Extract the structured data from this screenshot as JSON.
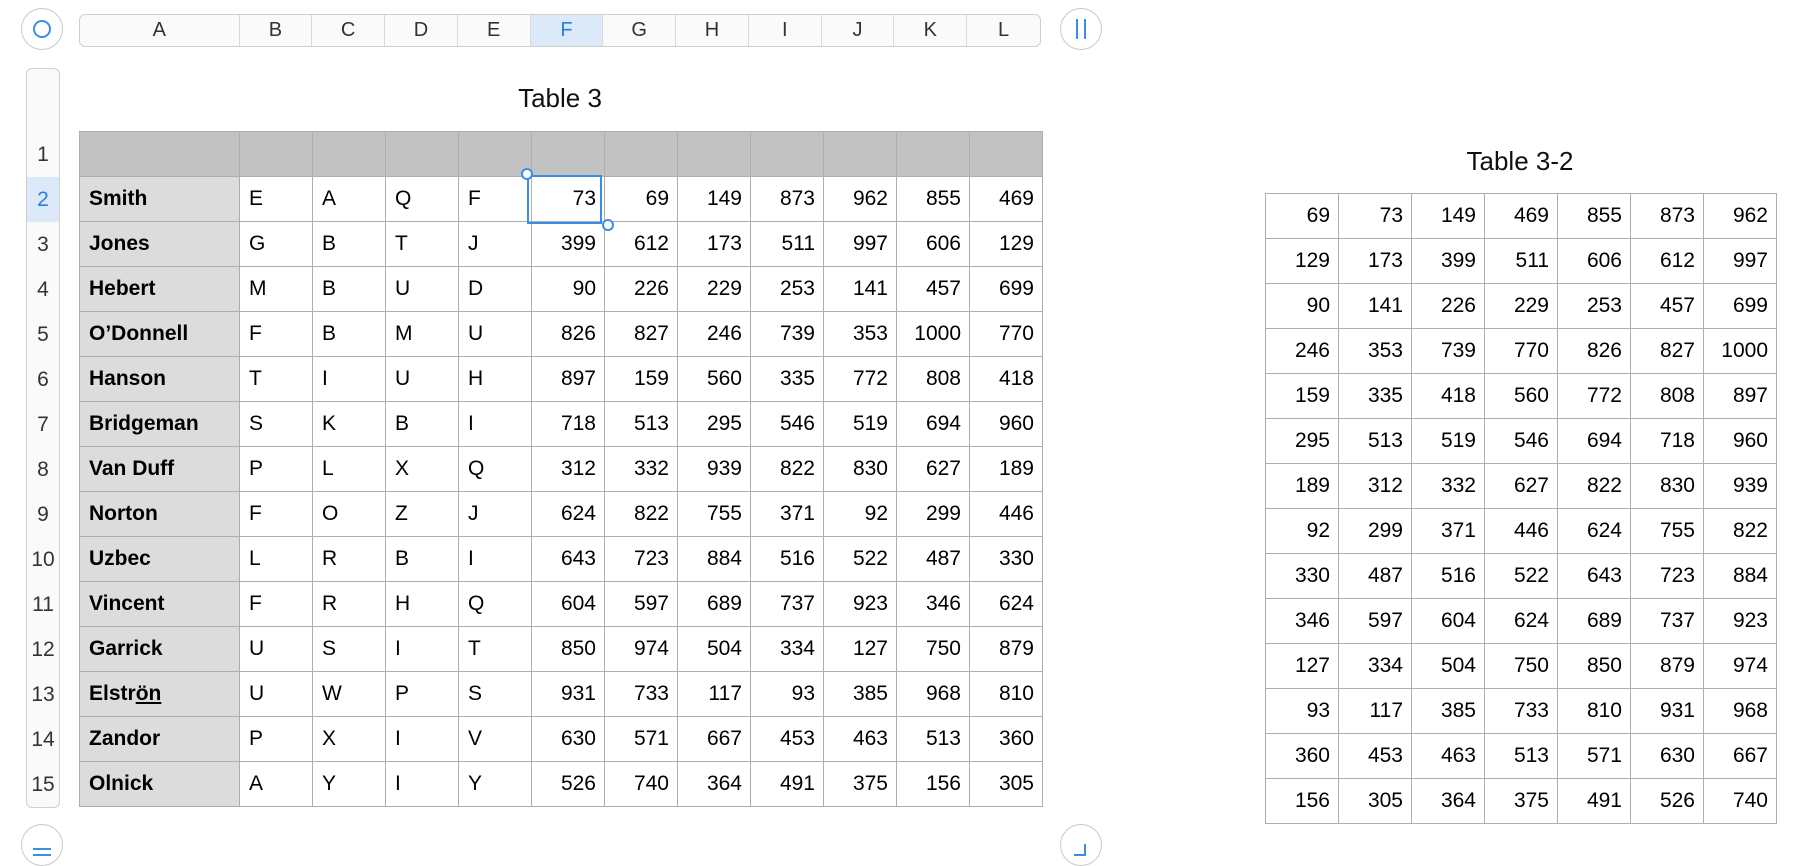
{
  "columns": [
    "A",
    "B",
    "C",
    "D",
    "E",
    "F",
    "G",
    "H",
    "I",
    "J",
    "K",
    "L"
  ],
  "selected_column": "F",
  "rows": [
    "1",
    "2",
    "3",
    "4",
    "5",
    "6",
    "7",
    "8",
    "9",
    "10",
    "11",
    "12",
    "13",
    "14",
    "15"
  ],
  "selected_row": "2",
  "table3": {
    "title": "Table 3",
    "rows": [
      {
        "name": "Smith",
        "letters": [
          "E",
          "A",
          "Q",
          "F"
        ],
        "values": [
          "73",
          "69",
          "149",
          "873",
          "962",
          "855",
          "469"
        ]
      },
      {
        "name": "Jones",
        "letters": [
          "G",
          "B",
          "T",
          "J"
        ],
        "values": [
          "399",
          "612",
          "173",
          "511",
          "997",
          "606",
          "129"
        ]
      },
      {
        "name": "Hebert",
        "letters": [
          "M",
          "B",
          "U",
          "D"
        ],
        "values": [
          "90",
          "226",
          "229",
          "253",
          "141",
          "457",
          "699"
        ]
      },
      {
        "name": "O’Donnell",
        "letters": [
          "F",
          "B",
          "M",
          "U"
        ],
        "values": [
          "826",
          "827",
          "246",
          "739",
          "353",
          "1000",
          "770"
        ]
      },
      {
        "name": "Hanson",
        "letters": [
          "T",
          "I",
          "U",
          "H"
        ],
        "values": [
          "897",
          "159",
          "560",
          "335",
          "772",
          "808",
          "418"
        ]
      },
      {
        "name": "Bridgeman",
        "letters": [
          "S",
          "K",
          "B",
          "I"
        ],
        "values": [
          "718",
          "513",
          "295",
          "546",
          "519",
          "694",
          "960"
        ]
      },
      {
        "name": "Van Duff",
        "letters": [
          "P",
          "L",
          "X",
          "Q"
        ],
        "values": [
          "312",
          "332",
          "939",
          "822",
          "830",
          "627",
          "189"
        ]
      },
      {
        "name": "Norton",
        "letters": [
          "F",
          "O",
          "Z",
          "J"
        ],
        "values": [
          "624",
          "822",
          "755",
          "371",
          "92",
          "299",
          "446"
        ]
      },
      {
        "name": "Uzbec",
        "letters": [
          "L",
          "R",
          "B",
          "I"
        ],
        "values": [
          "643",
          "723",
          "884",
          "516",
          "522",
          "487",
          "330"
        ]
      },
      {
        "name": "Vincent",
        "letters": [
          "F",
          "R",
          "H",
          "Q"
        ],
        "values": [
          "604",
          "597",
          "689",
          "737",
          "923",
          "346",
          "624"
        ]
      },
      {
        "name": "Garrick",
        "letters": [
          "U",
          "S",
          "I",
          "T"
        ],
        "values": [
          "850",
          "974",
          "504",
          "334",
          "127",
          "750",
          "879"
        ]
      },
      {
        "name": "Elströn",
        "letters": [
          "U",
          "W",
          "P",
          "S"
        ],
        "values": [
          "931",
          "733",
          "117",
          "93",
          "385",
          "968",
          "810"
        ]
      },
      {
        "name": "Zandor",
        "letters": [
          "P",
          "X",
          "I",
          "V"
        ],
        "values": [
          "630",
          "571",
          "667",
          "453",
          "463",
          "513",
          "360"
        ]
      },
      {
        "name": "Olnick",
        "letters": [
          "A",
          "Y",
          "I",
          "Y"
        ],
        "values": [
          "526",
          "740",
          "364",
          "491",
          "375",
          "156",
          "305"
        ]
      }
    ]
  },
  "table32": {
    "title": "Table 3-2",
    "rows": [
      [
        "69",
        "73",
        "149",
        "469",
        "855",
        "873",
        "962"
      ],
      [
        "129",
        "173",
        "399",
        "511",
        "606",
        "612",
        "997"
      ],
      [
        "90",
        "141",
        "226",
        "229",
        "253",
        "457",
        "699"
      ],
      [
        "246",
        "353",
        "739",
        "770",
        "826",
        "827",
        "1000"
      ],
      [
        "159",
        "335",
        "418",
        "560",
        "772",
        "808",
        "897"
      ],
      [
        "295",
        "513",
        "519",
        "546",
        "694",
        "718",
        "960"
      ],
      [
        "189",
        "312",
        "332",
        "627",
        "822",
        "830",
        "939"
      ],
      [
        "92",
        "299",
        "371",
        "446",
        "624",
        "755",
        "822"
      ],
      [
        "330",
        "487",
        "516",
        "522",
        "643",
        "723",
        "884"
      ],
      [
        "346",
        "597",
        "604",
        "624",
        "689",
        "737",
        "923"
      ],
      [
        "127",
        "334",
        "504",
        "750",
        "850",
        "879",
        "974"
      ],
      [
        "93",
        "117",
        "385",
        "733",
        "810",
        "931",
        "968"
      ],
      [
        "360",
        "453",
        "463",
        "513",
        "571",
        "630",
        "667"
      ],
      [
        "156",
        "305",
        "364",
        "375",
        "491",
        "526",
        "740"
      ]
    ]
  }
}
